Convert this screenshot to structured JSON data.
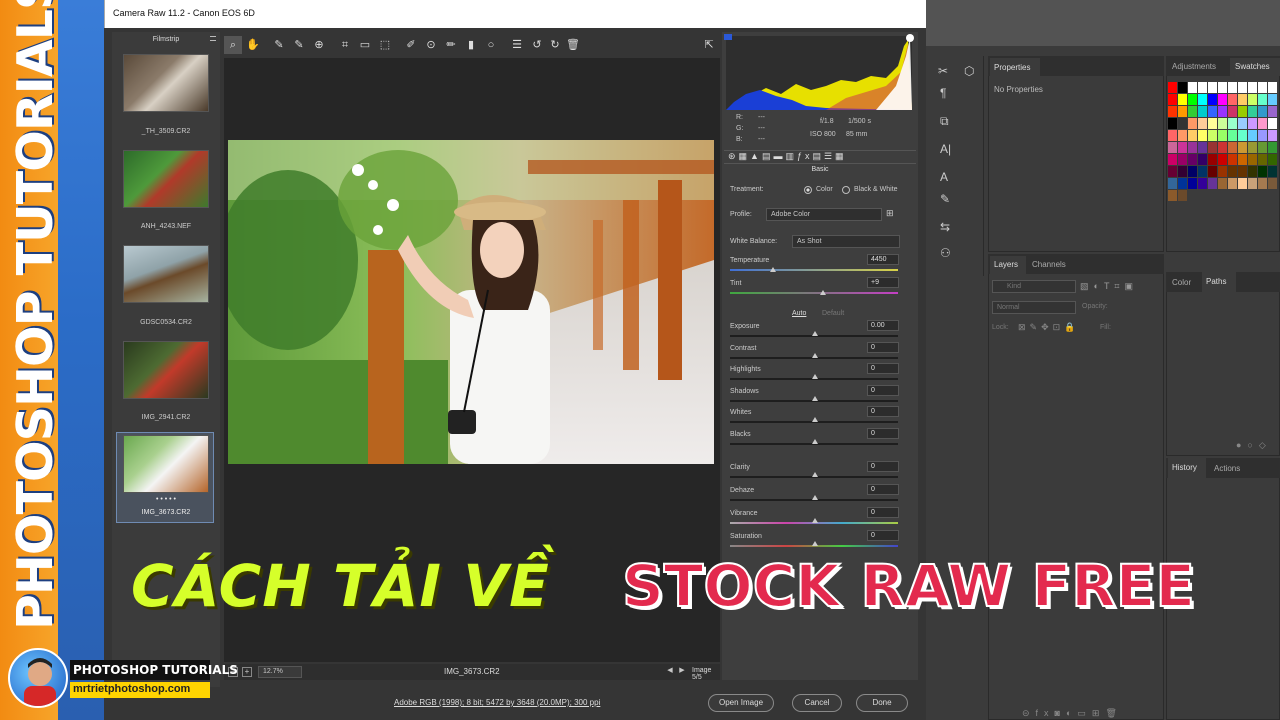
{
  "banner": {
    "text": "PHOTOSHOP TUTORIALS"
  },
  "window": {
    "title": "Camera Raw 11.2  -  Canon EOS 6D"
  },
  "filmstrip": {
    "header": "Filmstrip",
    "items": [
      {
        "label": "_TH_3509.CR2"
      },
      {
        "label": "ANH_4243.NEF"
      },
      {
        "label": "GDSC0534.CR2"
      },
      {
        "label": "IMG_2941.CR2"
      },
      {
        "label": "IMG_3673.CR2"
      }
    ],
    "rating": "• • • • •"
  },
  "toolbar": {
    "tools": [
      "zoom-tool",
      "hand-tool",
      "white-balance-tool",
      "color-sampler-tool",
      "targeted-adjustment-tool",
      "crop-tool",
      "straighten-tool",
      "transform-tool",
      "spot-removal-tool",
      "red-eye-tool",
      "adjustment-brush",
      "graduated-filter",
      "radial-filter",
      "preferences",
      "rotate-left",
      "rotate-right",
      "delete"
    ]
  },
  "bottombar": {
    "zoom": "12.7%",
    "filename": "IMG_3673.CR2",
    "image_nav": "Image 5/5",
    "y_label": "Y"
  },
  "status": {
    "workflow_link": "Adobe RGB (1998); 8 bit; 5472 by 3648 (20.0MP); 300 ppi",
    "open_image": "Open Image",
    "cancel": "Cancel",
    "done": "Done"
  },
  "readout": {
    "r": "R:",
    "g": "G:",
    "b": "B:",
    "r_val": "---",
    "g_val": "---",
    "b_val": "---",
    "aperture": "f/1.8",
    "shutter": "1/500 s",
    "iso": "ISO 800",
    "focal": "85 mm"
  },
  "basic": {
    "panel_title": "Basic",
    "treatment_label": "Treatment:",
    "treatment_color": "Color",
    "treatment_bw": "Black & White",
    "profile_label": "Profile:",
    "profile_value": "Adobe Color",
    "wb_label": "White Balance:",
    "wb_value": "As Shot",
    "temperature_label": "Temperature",
    "temperature_value": "4450",
    "tint_label": "Tint",
    "tint_value": "+9",
    "auto": "Auto",
    "default": "Default",
    "sliders": [
      {
        "label": "Exposure",
        "value": "0.00"
      },
      {
        "label": "Contrast",
        "value": "0"
      },
      {
        "label": "Highlights",
        "value": "0"
      },
      {
        "label": "Shadows",
        "value": "0"
      },
      {
        "label": "Whites",
        "value": "0"
      },
      {
        "label": "Blacks",
        "value": "0"
      },
      {
        "label": "Clarity",
        "value": "0"
      },
      {
        "label": "Dehaze",
        "value": "0"
      },
      {
        "label": "Vibrance",
        "value": "0"
      },
      {
        "label": "Saturation",
        "value": "0"
      }
    ]
  },
  "ps": {
    "properties_tab": "Properties",
    "no_properties": "No Properties",
    "adjustments_tab": "Adjustments",
    "swatches_tab": "Swatches",
    "layers_tab": "Layers",
    "channels_tab": "Channels",
    "kind_placeholder": "Kind",
    "blend_mode": "Normal",
    "opacity_label": "Opacity:",
    "lock_label": "Lock:",
    "fill_label": "Fill:",
    "color_tab": "Color",
    "paths_tab": "Paths",
    "history_tab": "History",
    "actions_tab": "Actions"
  },
  "overlay": {
    "left_text": "CÁCH TẢI VỀ",
    "right_text": "STOCK RAW FREE",
    "brand_title": "PHOTOSHOP TUTORIALS",
    "brand_url": "mrtrietphotoshop.com",
    "brand_shadow": "TUTORIALS"
  },
  "colors": {
    "accent_yellow": "#d6ff2a",
    "accent_red": "#e32a4e",
    "banner_orange": "#f28b12",
    "banner_blue": "#2b6cc7"
  }
}
